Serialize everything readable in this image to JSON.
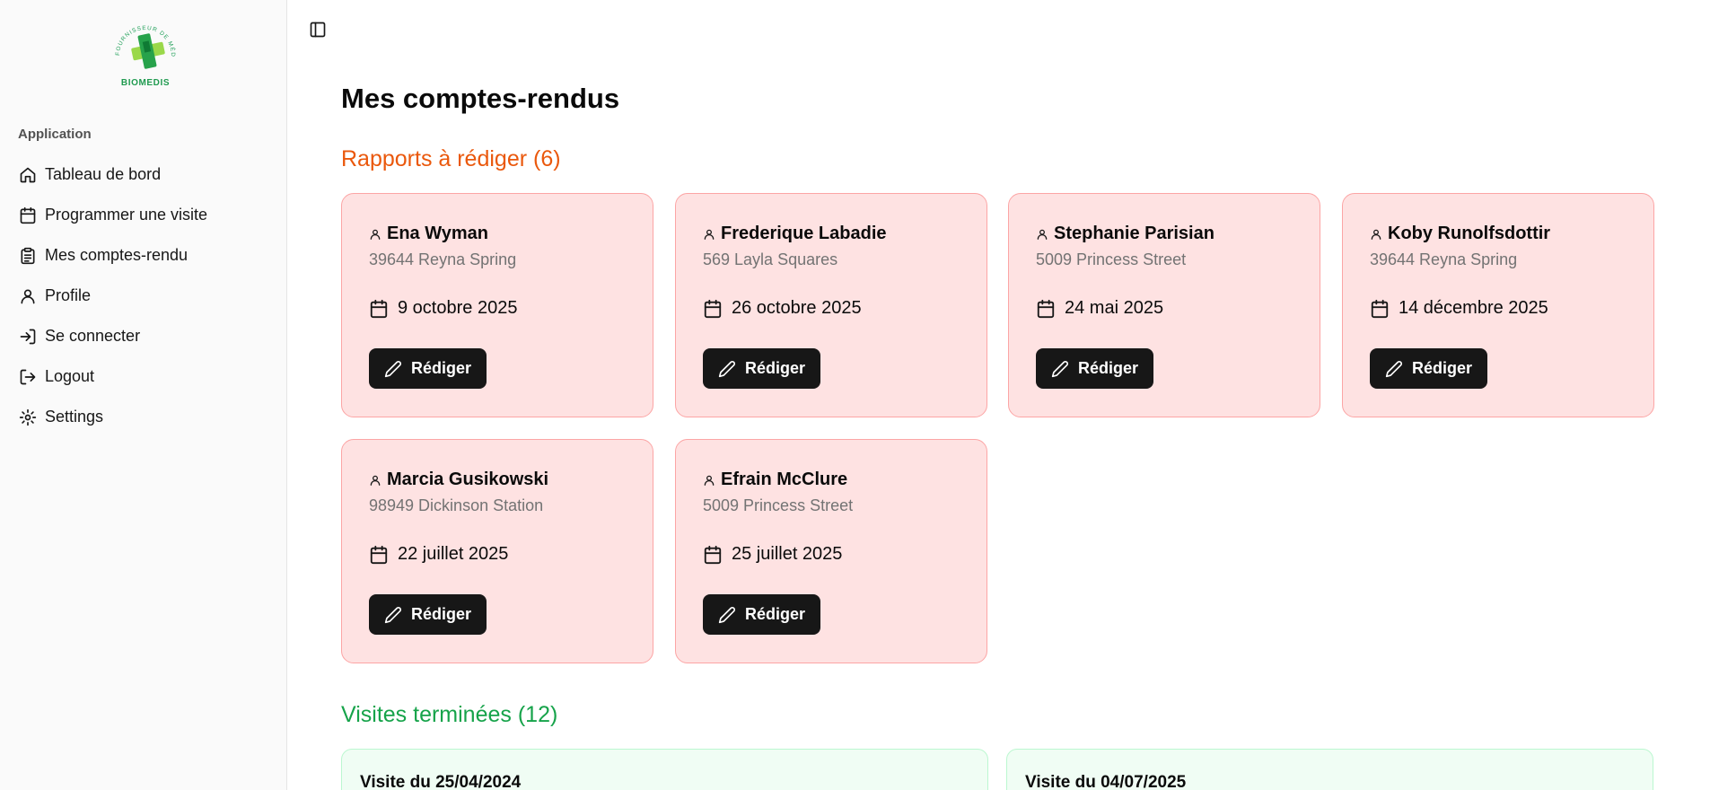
{
  "brand": {
    "logo_text": "BIOMEDIS",
    "logo_ring_text": "FOURNISSEUR DE MÉDICAMENTS"
  },
  "sidebar": {
    "group_label": "Application",
    "items": [
      {
        "label": "Tableau de bord",
        "icon": "home-icon"
      },
      {
        "label": "Programmer une visite",
        "icon": "calendar-icon"
      },
      {
        "label": "Mes comptes-rendu",
        "icon": "clipboard-icon"
      },
      {
        "label": "Profile",
        "icon": "user-icon"
      },
      {
        "label": "Se connecter",
        "icon": "login-icon"
      },
      {
        "label": "Logout",
        "icon": "logout-icon"
      },
      {
        "label": "Settings",
        "icon": "gear-icon"
      }
    ]
  },
  "main": {
    "title": "Mes comptes-rendus",
    "todo_section": {
      "title": "Rapports à rédiger (6)",
      "button_label": "Rédiger",
      "cards": [
        {
          "name": "Ena Wyman",
          "address": "39644 Reyna Spring",
          "date": "9 octobre 2025"
        },
        {
          "name": "Frederique Labadie",
          "address": "569 Layla Squares",
          "date": "26 octobre 2025"
        },
        {
          "name": "Stephanie Parisian",
          "address": "5009 Princess Street",
          "date": "24 mai 2025"
        },
        {
          "name": "Koby Runolfsdottir",
          "address": "39644 Reyna Spring",
          "date": "14 décembre 2025"
        },
        {
          "name": "Marcia Gusikowski",
          "address": "98949 Dickinson Station",
          "date": "22 juillet 2025"
        },
        {
          "name": "Efrain McClure",
          "address": "5009 Princess Street",
          "date": "25 juillet 2025"
        }
      ]
    },
    "done_section": {
      "title": "Visites terminées (12)",
      "cards": [
        {
          "title": "Visite du 25/04/2024"
        },
        {
          "title": "Visite du 04/07/2025"
        }
      ]
    }
  },
  "colors": {
    "accent_todo": "#ea580c",
    "accent_done": "#16a34a",
    "card_todo_bg": "#fee2e2",
    "card_done_bg": "#f0fdf4",
    "button_bg": "#171717"
  }
}
